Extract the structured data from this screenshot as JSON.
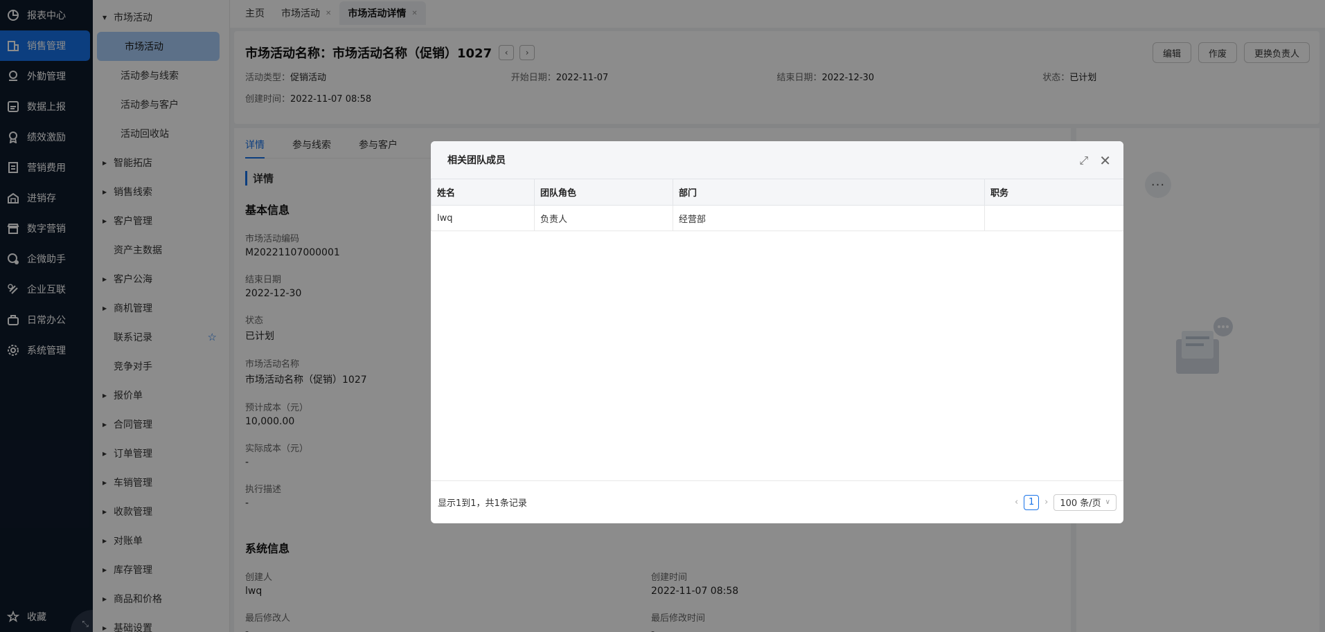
{
  "nav": {
    "items": [
      {
        "label": "报表中心",
        "icon": "report-icon"
      },
      {
        "label": "销售管理",
        "icon": "building-icon",
        "active": true
      },
      {
        "label": "外勤管理",
        "icon": "location-icon"
      },
      {
        "label": "数据上报",
        "icon": "upload-icon"
      },
      {
        "label": "绩效激励",
        "icon": "award-icon"
      },
      {
        "label": "营销费用",
        "icon": "receipt-icon"
      },
      {
        "label": "进销存",
        "icon": "warehouse-icon"
      },
      {
        "label": "数字营销",
        "icon": "shop-icon"
      },
      {
        "label": "企微助手",
        "icon": "chat-icon"
      },
      {
        "label": "企业互联",
        "icon": "link-icon"
      },
      {
        "label": "日常办公",
        "icon": "briefcase-icon"
      },
      {
        "label": "系统管理",
        "icon": "gear-icon"
      }
    ],
    "favorites": "收藏"
  },
  "submenu": {
    "items": [
      {
        "label": "市场活动",
        "type": "parent"
      },
      {
        "label": "市场活动",
        "type": "child",
        "active": true
      },
      {
        "label": "活动参与线索",
        "type": "child"
      },
      {
        "label": "活动参与客户",
        "type": "child"
      },
      {
        "label": "活动回收站",
        "type": "child"
      },
      {
        "label": "智能拓店",
        "type": "collapsed"
      },
      {
        "label": "销售线索",
        "type": "collapsed"
      },
      {
        "label": "客户管理",
        "type": "collapsed"
      },
      {
        "label": "资产主数据",
        "type": "plain"
      },
      {
        "label": "客户公海",
        "type": "collapsed"
      },
      {
        "label": "商机管理",
        "type": "collapsed"
      },
      {
        "label": "联系记录",
        "type": "plain",
        "starred": true
      },
      {
        "label": "竞争对手",
        "type": "plain"
      },
      {
        "label": "报价单",
        "type": "collapsed"
      },
      {
        "label": "合同管理",
        "type": "collapsed"
      },
      {
        "label": "订单管理",
        "type": "collapsed"
      },
      {
        "label": "车销管理",
        "type": "collapsed"
      },
      {
        "label": "收款管理",
        "type": "collapsed"
      },
      {
        "label": "对账单",
        "type": "collapsed"
      },
      {
        "label": "库存管理",
        "type": "collapsed"
      },
      {
        "label": "商品和价格",
        "type": "collapsed"
      },
      {
        "label": "基础设置",
        "type": "collapsed"
      }
    ]
  },
  "tabs": [
    {
      "label": "主页",
      "closable": false
    },
    {
      "label": "市场活动",
      "closable": true
    },
    {
      "label": "市场活动详情",
      "closable": true,
      "active": true
    }
  ],
  "header": {
    "title": "市场活动名称：市场活动名称（促销）1027",
    "actions": [
      "编辑",
      "作废",
      "更换负责人"
    ],
    "meta": [
      {
        "label": "活动类型：",
        "value": "促销活动"
      },
      {
        "label": "开始日期：",
        "value": "2022-11-07"
      },
      {
        "label": "结束日期：",
        "value": "2022-12-30"
      },
      {
        "label": "状态：",
        "value": "已计划"
      }
    ],
    "created": {
      "label": "创建时间：",
      "value": "2022-11-07 08:58"
    }
  },
  "detail": {
    "tabs": [
      "详情",
      "参与线索",
      "参与客户"
    ],
    "section": "详情",
    "basic_title": "基本信息",
    "fields": [
      {
        "label": "市场活动编码",
        "value": "M20221107000001"
      },
      {
        "label": "结束日期",
        "value": "2022-12-30"
      },
      {
        "label": "状态",
        "value": "已计划"
      },
      {
        "label": "市场活动名称",
        "value": "市场活动名称（促销）1027"
      },
      {
        "label": "预计成本（元）",
        "value": "10,000.00"
      },
      {
        "label": "实际成本（元）",
        "value": "-"
      },
      {
        "label": "执行描述",
        "value": "-"
      }
    ],
    "system_title": "系统信息",
    "system_fields": [
      {
        "label": "创建人",
        "value": "lwq"
      },
      {
        "label": "创建时间",
        "value": "2022-11-07 08:58"
      },
      {
        "label": "最后修改人",
        "value": "-"
      },
      {
        "label": "最后修改时间",
        "value": "-"
      }
    ]
  },
  "modal": {
    "title": "相关团队成员",
    "columns": [
      "姓名",
      "团队角色",
      "部门",
      "职务"
    ],
    "rows": [
      [
        "lwq",
        "负责人",
        "经营部",
        ""
      ]
    ],
    "footer_info": "显示1到1，共1条记录",
    "page": "1",
    "page_size": "100 条/页"
  },
  "colors": {
    "accent": "#1772e8",
    "nav_bg": "#0e1a2b"
  }
}
